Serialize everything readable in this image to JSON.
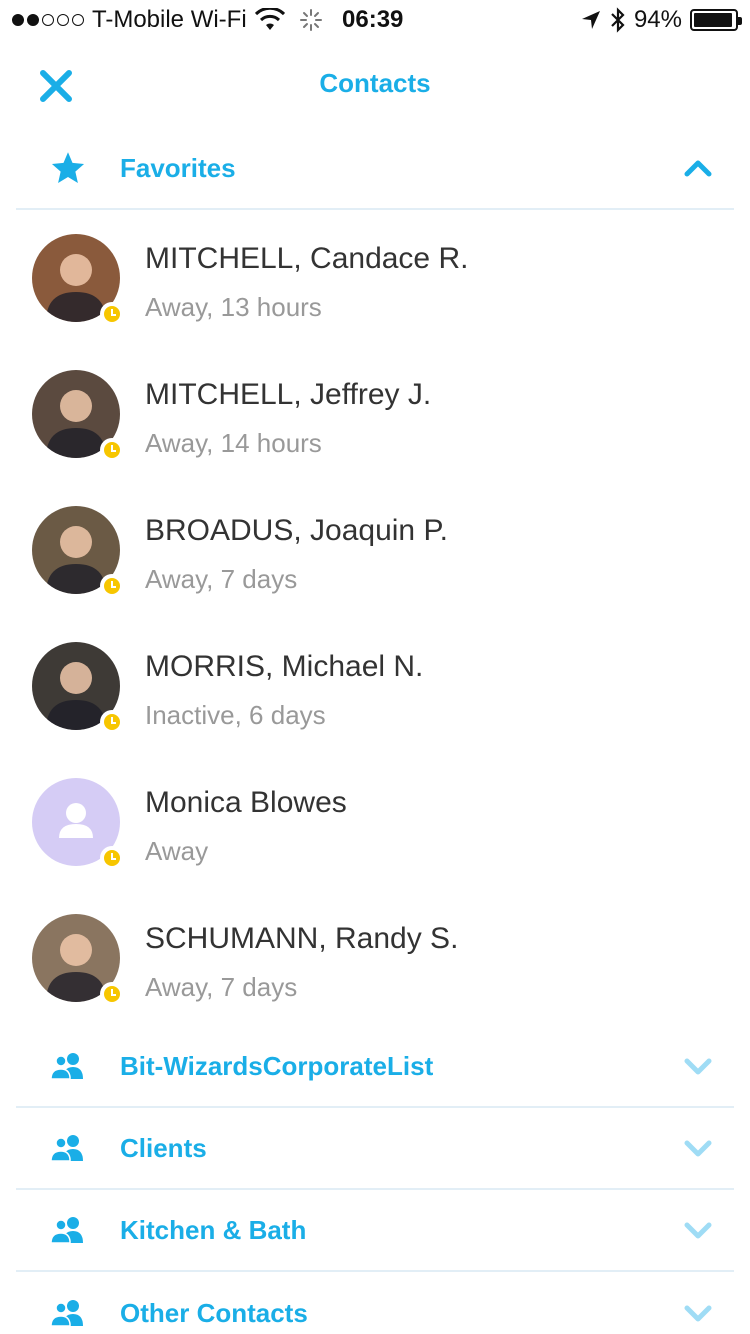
{
  "status_bar": {
    "carrier": "T-Mobile Wi-Fi",
    "time": "06:39",
    "battery": "94%",
    "battery_level": 0.94,
    "signal_bars_filled": 2,
    "signal_bars_total": 5
  },
  "nav": {
    "title": "Contacts",
    "close_icon": "close-icon"
  },
  "favorites": {
    "label": "Favorites",
    "icon": "star-icon",
    "expanded": true
  },
  "contacts": [
    {
      "name": "MITCHELL, Candace R.",
      "status": "Away, 13 hours",
      "presence": "away",
      "avatar_color": "#8a5a3c"
    },
    {
      "name": "MITCHELL, Jeffrey J.",
      "status": "Away, 14 hours",
      "presence": "away",
      "avatar_color": "#5b4a3f"
    },
    {
      "name": "BROADUS, Joaquin P.",
      "status": "Away, 7 days",
      "presence": "away",
      "avatar_color": "#6b5a45"
    },
    {
      "name": "MORRIS, Michael N.",
      "status": "Inactive, 6 days",
      "presence": "away",
      "avatar_color": "#3e3a36"
    },
    {
      "name": "Monica Blowes",
      "status": "Away",
      "presence": "away",
      "avatar_color": "#d5ccf5"
    },
    {
      "name": "SCHUMANN, Randy S.",
      "status": "Away, 7 days",
      "presence": "away",
      "avatar_color": "#8a7560"
    }
  ],
  "groups": [
    {
      "label": "Bit-WizardsCorporateList",
      "icon": "group-icon"
    },
    {
      "label": "Clients",
      "icon": "group-icon"
    },
    {
      "label": "Kitchen & Bath",
      "icon": "group-icon"
    },
    {
      "label": "Other Contacts",
      "icon": "group-icon"
    }
  ],
  "colors": {
    "accent": "#1aaee7",
    "presence_away": "#f7c600",
    "chevron_light": "#9fdcf5",
    "divider": "#e2eef6"
  }
}
